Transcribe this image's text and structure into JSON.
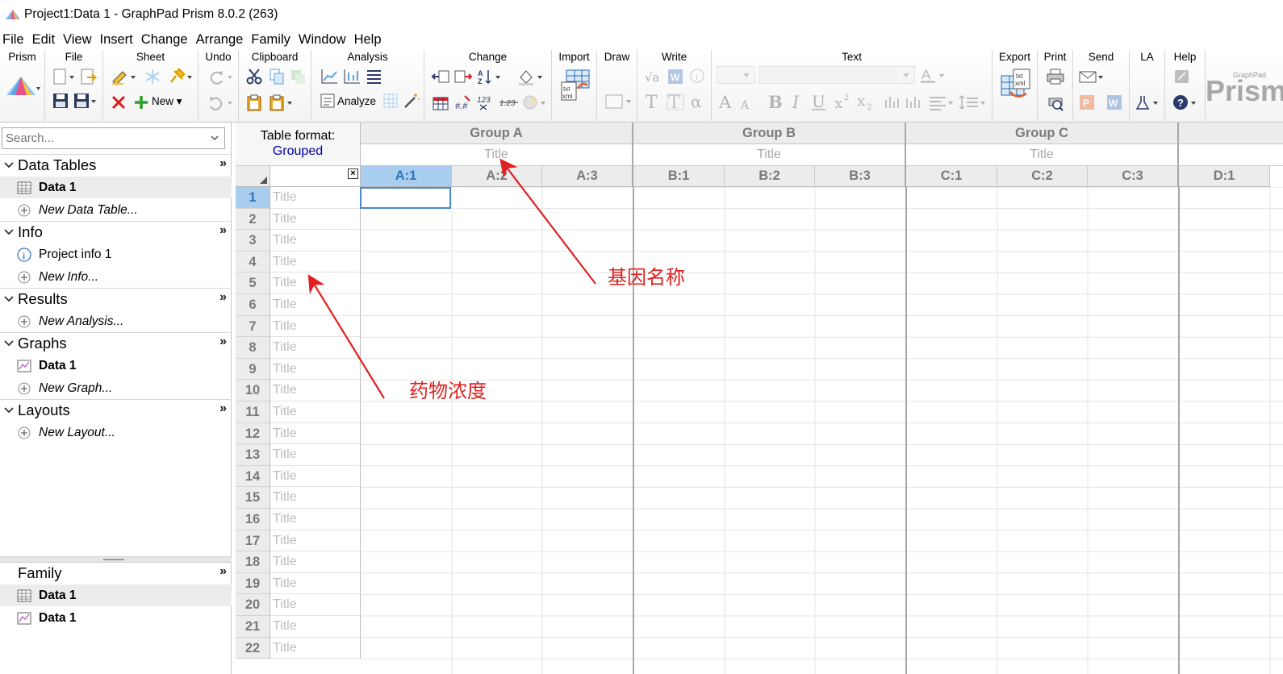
{
  "window": {
    "title": "Project1:Data 1 - GraphPad Prism 8.0.2 (263)"
  },
  "menu": [
    {
      "label": "File"
    },
    {
      "label": "Edit"
    },
    {
      "label": "View"
    },
    {
      "label": "Insert"
    },
    {
      "label": "Change"
    },
    {
      "label": "Arrange"
    },
    {
      "label": "Family"
    },
    {
      "label": "Window"
    },
    {
      "label": "Help"
    }
  ],
  "ribbon": {
    "groups": {
      "prism": "Prism",
      "file": "File",
      "sheet": "Sheet",
      "undo": "Undo",
      "clipboard": "Clipboard",
      "analysis": "Analysis",
      "change": "Change",
      "import": "Import",
      "draw": "Draw",
      "write": "Write",
      "text": "Text",
      "export": "Export",
      "print": "Print",
      "send": "Send",
      "la": "LA",
      "help": "Help"
    },
    "new_label": "New",
    "analyze_label": "Analyze",
    "brand": "Prism",
    "brand_small": "GraphPad"
  },
  "navigator": {
    "search_placeholder": "Search...",
    "sections": {
      "data_tables": "Data Tables",
      "info": "Info",
      "results": "Results",
      "graphs": "Graphs",
      "layouts": "Layouts",
      "family": "Family"
    },
    "items": {
      "data1": "Data 1",
      "new_data_table": "New Data Table...",
      "project_info": "Project info 1",
      "new_info": "New Info...",
      "new_analysis": "New Analysis...",
      "graph_data1": "Data 1",
      "new_graph": "New Graph...",
      "new_layout": "New Layout...",
      "family_table": "Data 1",
      "family_graph": "Data 1"
    },
    "more_glyph": "»"
  },
  "sheet": {
    "table_format_label": "Table format:",
    "table_format_value": "Grouped",
    "groups": [
      {
        "name": "Group A",
        "title_placeholder": "Title"
      },
      {
        "name": "Group B",
        "title_placeholder": "Title"
      },
      {
        "name": "Group C",
        "title_placeholder": "Title"
      }
    ],
    "columns": [
      "A:1",
      "A:2",
      "A:3",
      "B:1",
      "B:2",
      "B:3",
      "C:1",
      "C:2",
      "C:3",
      "D:1"
    ],
    "active_column": "A:1",
    "row_title_placeholder": "Title",
    "rows": [
      "1",
      "2",
      "3",
      "4",
      "5",
      "6",
      "7",
      "8",
      "9",
      "10",
      "11",
      "12",
      "13",
      "14",
      "15",
      "16",
      "17",
      "18",
      "19",
      "20",
      "21",
      "22"
    ],
    "active_row": "1"
  },
  "annotations": {
    "gene_name": "基因名称",
    "drug_concentration": "药物浓度",
    "color": "#e02020"
  }
}
